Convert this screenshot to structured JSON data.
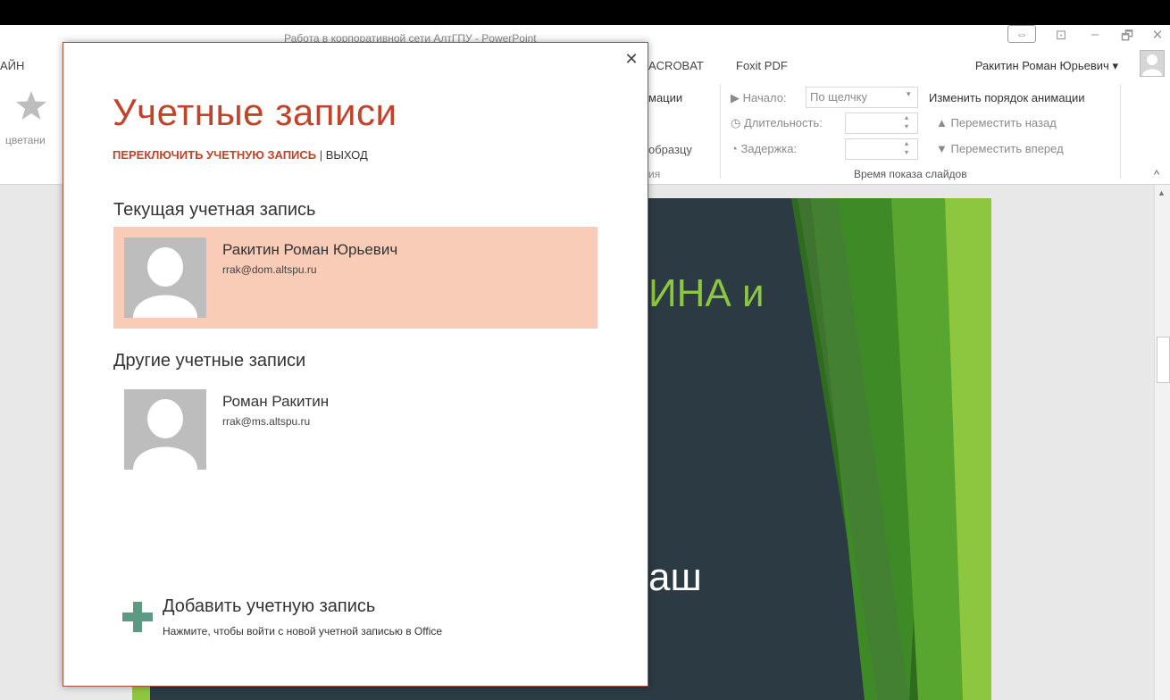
{
  "window": {
    "title": "Работа в корпоративной сети АлтГПУ - PowerPoint",
    "buttons": [
      "⇔",
      "⊡",
      "–",
      "🗗",
      "✕"
    ]
  },
  "ribbon_tabs": {
    "left_tab": "АЙН",
    "acrobat": "ACROBAT",
    "foxit": "Foxit PDF",
    "user_name": "Ракитин Роман Юрьевич",
    "user_dropdown": "▾"
  },
  "ribbon": {
    "left_caption": "цветани",
    "animation_label": "мации",
    "by_sample": "образцу",
    "group_left": "ия",
    "start_label": "Начало:",
    "start_value": "По щелчку",
    "duration_label": "Длительность:",
    "delay_label": "Задержка:",
    "reorder_title": "Изменить порядок анимации",
    "move_back": "Переместить назад",
    "move_forward": "Переместить вперед",
    "timing_group": "Время показа слайдов",
    "collapse": "^"
  },
  "slide": {
    "text_top": "ИНА и",
    "text_bottom": "аш"
  },
  "dialog": {
    "title": "Учетные записи",
    "switch_link": "ПЕРЕКЛЮЧИТЬ УЧЕТНУЮ ЗАПИСЬ",
    "separator": " | ",
    "exit_link": "ВЫХОД",
    "close": "✕",
    "current_section": "Текущая учетная запись",
    "current_account": {
      "name": "Ракитин Роман Юрьевич",
      "email": "rrak@dom.altspu.ru"
    },
    "other_section": "Другие учетные записи",
    "other_account": {
      "name": "Роман Ракитин",
      "email": "rrak@ms.altspu.ru"
    },
    "add_title": "Добавить учетную запись",
    "add_subtitle": "Нажмите, чтобы войти с новой учетной записью в Office"
  },
  "colors": {
    "accent": "#c1432a",
    "selected_account_bg": "#f8ccb7",
    "add_icon": "#5d9a83",
    "slide_bg": "#2c3a44",
    "slide_green": "#8dc63f"
  }
}
